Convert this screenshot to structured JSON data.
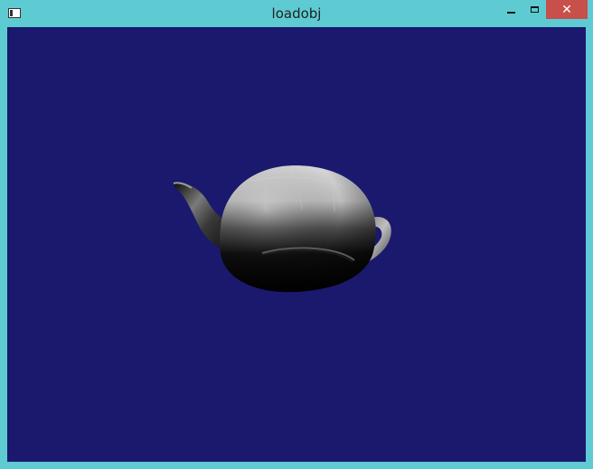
{
  "window": {
    "title": "loadobj",
    "controls": {
      "minimize_icon": "minimize-icon",
      "maximize_icon": "maximize-icon",
      "close_icon": "close-icon",
      "close_glyph": "✕"
    }
  },
  "viewport": {
    "background": "#1a196e",
    "object": "teapot"
  },
  "colors": {
    "frame": "#5ecbd2",
    "close_button": "#c7504a"
  }
}
